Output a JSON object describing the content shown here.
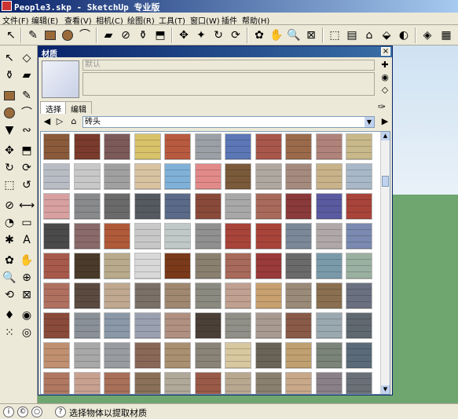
{
  "window": {
    "title": "People3.skp - SketchUp 专业版"
  },
  "menu": [
    "文件(F)",
    "编辑(E)",
    "查看(V)",
    "相机(C)",
    "绘图(R)",
    "工具(T)",
    "窗口(W)",
    "插件",
    "帮助(H)"
  ],
  "materials_panel": {
    "title": "材质",
    "name_placeholder": "默认",
    "tabs": [
      "选择",
      "编辑"
    ],
    "active_tab": 0,
    "collection": "砖头",
    "close_label": "×"
  },
  "status": {
    "text": "选择物体以提取材质"
  },
  "icons": {
    "toolbar": [
      "select-icon",
      "pencil-icon",
      "rectangle-icon",
      "circle-icon",
      "arc-icon",
      "eraser-icon",
      "tape-measure-icon",
      "paint-bucket-icon",
      "push-pull-icon",
      "move-icon",
      "rotate-icon",
      "follow-me-icon",
      "orbit-icon",
      "pan-icon",
      "zoom-icon",
      "zoom-extents-icon",
      "section-icon",
      "warehouse-icon",
      "component-icon",
      "share-icon",
      "materials-icon",
      "layer-icon"
    ],
    "left": [
      "select-icon",
      "component-icon",
      "paint-bucket-icon",
      "eraser-icon",
      "rectangle-icon",
      "line-icon",
      "circle-icon",
      "arc-icon",
      "polygon-icon",
      "freehand-icon",
      "move-icon",
      "push-pull-icon",
      "rotate-icon",
      "follow-me-icon",
      "scale-icon",
      "offset-icon",
      "tape-measure-icon",
      "dimension-icon",
      "protractor-icon",
      "text-icon",
      "axes-icon",
      "3d-text-icon",
      "orbit-icon",
      "pan-icon",
      "zoom-icon",
      "zoom-window-icon",
      "previous-view-icon",
      "zoom-extents-icon",
      "position-camera-icon",
      "look-around-icon",
      "walk-icon",
      "section-plane-icon"
    ]
  },
  "colors": {
    "titlebar": "#0a246a",
    "ground": "#6fa56f",
    "sky": "#cfe2f2",
    "material_tiles": [
      "#8a5a3a",
      "#7a3b2c",
      "#7d5a5a",
      "#d8c26a",
      "#b85a3f",
      "#9aa0a6",
      "#5b77b6",
      "#a8574a",
      "#9a6a4a",
      "#b0837a",
      "#c8b88a",
      "#b8bcc4",
      "#c8c8c8",
      "#a0a0a0",
      "#d8c2a0",
      "#7fb0d8",
      "#e28a8a",
      "#7a5a3a",
      "#b0a8a0",
      "#a58b7e",
      "#c8b28a",
      "#a8b8c8",
      "#d8a0a0",
      "#888a8c",
      "#6a6a6a",
      "#555a60",
      "#5a6a88",
      "#8a4a3a",
      "#a8a8a8",
      "#a86a5a",
      "#8a3a3a",
      "#5a5aa0",
      "#a8443a",
      "#4a4a4a",
      "#8a6a6a",
      "#b05a3a",
      "#c8c8c8",
      "#c0c8c8",
      "#909090",
      "#a8443a",
      "#a8443a",
      "#7a8898",
      "#b0a8a8",
      "#7a8ab0",
      "#a85a4a",
      "#4a3a2a",
      "#b8aa8a",
      "#d8d8d8",
      "#7a3a1a",
      "#8a8070",
      "#a86a5a",
      "#9a3a3a",
      "#6a6a6a",
      "#7a9aaa",
      "#9ab0a0",
      "#b07060",
      "#5a4a40",
      "#c0a890",
      "#7a7068",
      "#a08870",
      "#8a8a80",
      "#c0a090",
      "#c8a070",
      "#9a8a78",
      "#8a7050",
      "#6a7080",
      "#8a4a3a",
      "#8a9098",
      "#8a98a8",
      "#9aa0b0",
      "#b09080",
      "#4a4038",
      "#909088",
      "#a89a90",
      "#8a5a48",
      "#9aa8b0",
      "#606870",
      "#c09070",
      "#a8a8a8",
      "#989ca0",
      "#8a6858",
      "#a89070",
      "#8a8478",
      "#d8c8a0",
      "#6a6458",
      "#c0a070",
      "#7a8478",
      "#5a6a78",
      "#b07860",
      "#c8a090",
      "#a87058",
      "#8a7058",
      "#b0a898",
      "#9a5a48",
      "#b8a890",
      "#8a8070",
      "#c8a888",
      "#8a8088",
      "#6a7078"
    ]
  }
}
